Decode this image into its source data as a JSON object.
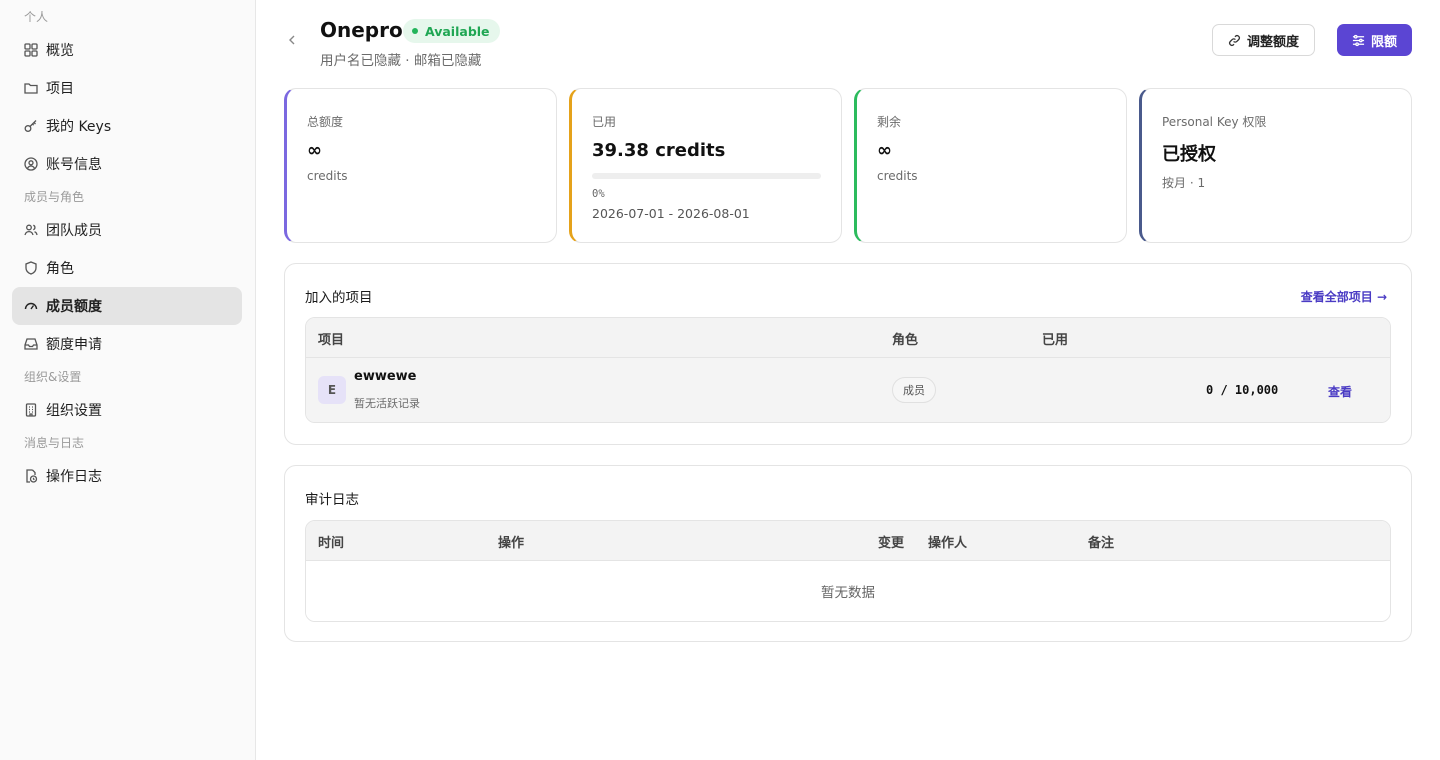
{
  "sidebar": {
    "section_personal": "个人",
    "section_members": "成员与角色",
    "section_org": "组织&设置",
    "section_logs": "消息与日志",
    "items": {
      "overview": "概览",
      "projects": "项目",
      "my_keys": "我的 Keys",
      "account": "账号信息",
      "team": "团队成员",
      "roles": "角色",
      "quota": "成员额度",
      "quota_request": "额度申请",
      "org_settings": "组织设置",
      "audit_log": "操作日志"
    },
    "active": "quota"
  },
  "header": {
    "name": "Onepro",
    "status": "Available",
    "subtitle": "用户名已隐藏 · 邮箱已隐藏",
    "adjust_button": "调整额度",
    "limit_button": "限额"
  },
  "cards": {
    "total": {
      "label": "总额度",
      "value": "∞",
      "unit": "credits",
      "color": "#7b68e0"
    },
    "used": {
      "label": "已用",
      "value": "39.38 credits",
      "percent_text": "0%",
      "percent": 0,
      "range": "2026-07-01 - 2026-08-01",
      "color": "#e5a21a"
    },
    "remaining": {
      "label": "剩余",
      "value": "∞",
      "unit": "credits",
      "color": "#2cbb5d"
    },
    "personal_key": {
      "label": "Personal Key 权限",
      "value": "已授权",
      "sub": "按月 · 1",
      "color": "#4a5a8c"
    }
  },
  "projects": {
    "title": "加入的项目",
    "view_all": "查看全部项目",
    "columns": {
      "project": "项目",
      "role": "角色",
      "used": "已用"
    },
    "rows": [
      {
        "initial": "E",
        "name": "ewwewe",
        "meta": "暂无活跃记录",
        "role": "成员",
        "usage": "0 / 10,000",
        "action": "查看"
      }
    ]
  },
  "audit": {
    "title": "审计日志",
    "columns": {
      "time": "时间",
      "action": "操作",
      "change": "变更",
      "operator": "操作人",
      "note": "备注"
    },
    "empty": "暂无数据"
  }
}
